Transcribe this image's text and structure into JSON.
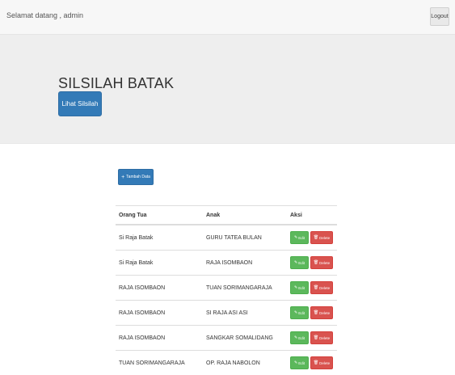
{
  "topbar": {
    "welcome": "Selamat datang , admin",
    "logout_label": "Logout"
  },
  "hero": {
    "title": "SILSILAH BATAK",
    "button_label": "Lihat Silsilah"
  },
  "toolbar": {
    "add_label": "Tambah Data"
  },
  "table": {
    "headers": [
      "Orang Tua",
      "Anak",
      "Aksi"
    ],
    "rows": [
      [
        "Si Raja Batak",
        "GURU TATEA BULAN"
      ],
      [
        "Si Raja Batak",
        "RAJA ISOMBAON"
      ],
      [
        "RAJA ISOMBAON",
        "TUAN SORIMANGARAJA"
      ],
      [
        "RAJA ISOMBAON",
        "SI RAJA ASI ASI"
      ],
      [
        "RAJA ISOMBAON",
        "SANGKAR SOMALIDANG"
      ],
      [
        "TUAN SORIMANGARAJA",
        "OP. RAJA NABOLON"
      ]
    ],
    "edit_label": "Edit",
    "delete_label": "Delete"
  }
}
